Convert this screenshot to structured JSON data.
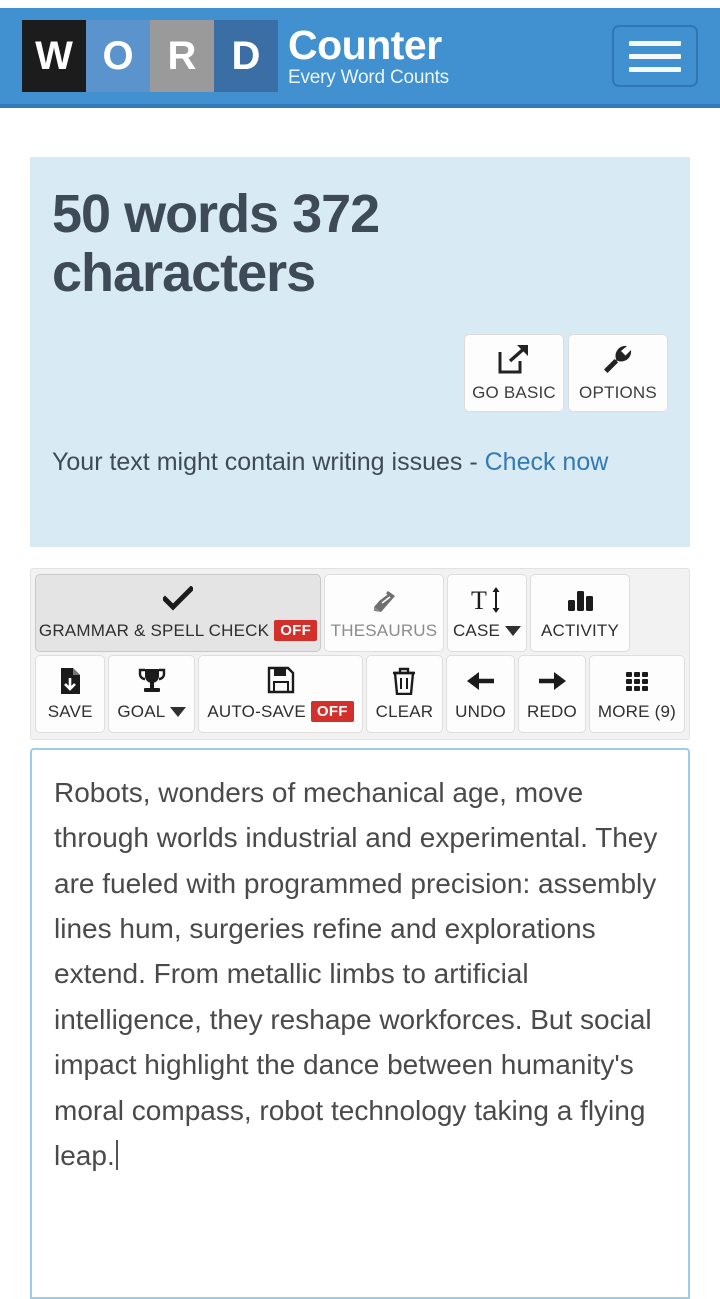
{
  "header": {
    "logo_tiles": [
      "W",
      "O",
      "R",
      "D"
    ],
    "brand_main": "Counter",
    "brand_sub": "Every Word Counts",
    "menu_icon": "hamburger-icon",
    "colors": {
      "header_bg": "#4190cf",
      "header_border": "#337ab7",
      "tile_w": "#1c1c1c",
      "tile_o": "#5b93cd",
      "tile_r": "#9a9a9a",
      "tile_d": "#3a6ea5"
    }
  },
  "stats": {
    "title": "50 words 372 characters",
    "word_count": 50,
    "character_count": 372,
    "panel_bg": "#d8eaf4",
    "actions": [
      {
        "label": "GO BASIC",
        "icon": "external-link-icon"
      },
      {
        "label": "OPTIONS",
        "icon": "wrench-icon"
      }
    ],
    "notice_text": "Your text might contain writing issues - ",
    "notice_link": "Check now",
    "link_color": "#337ab7"
  },
  "toolbar": {
    "row1": [
      {
        "label": "GRAMMAR & SPELL CHECK",
        "icon": "check-icon",
        "badge": "OFF",
        "state": "active"
      },
      {
        "label": "THESAURUS",
        "icon": "book-icon",
        "state": "disabled"
      },
      {
        "label": "CASE",
        "icon": "text-size-icon",
        "caret": true
      },
      {
        "label": "ACTIVITY",
        "icon": "bar-chart-icon"
      }
    ],
    "row2": [
      {
        "label": "SAVE",
        "icon": "file-download-icon"
      },
      {
        "label": "GOAL",
        "icon": "trophy-icon",
        "caret": true
      },
      {
        "label": "AUTO-SAVE",
        "icon": "floppy-disk-icon",
        "badge": "OFF"
      },
      {
        "label": "CLEAR",
        "icon": "trash-icon"
      },
      {
        "label": "UNDO",
        "icon": "arrow-left-icon"
      },
      {
        "label": "REDO",
        "icon": "arrow-right-icon"
      },
      {
        "label": "MORE (9)",
        "icon": "grid-icon"
      }
    ],
    "badge_color": "#d32f2b",
    "panel_bg": "#f2f2f2"
  },
  "editor": {
    "content": "Robots, wonders of mechanical age, move through worlds industrial and experimental. They are fueled with programmed precision: assembly lines hum, surgeries refine and explorations extend. From metallic limbs to artificial intelligence, they reshape workforces. But social impact highlight the dance between humanity's moral compass, robot technology taking a flying leap.",
    "border_color": "#9ecbe8",
    "text_color": "#4a4a4a",
    "has_cursor": true
  }
}
